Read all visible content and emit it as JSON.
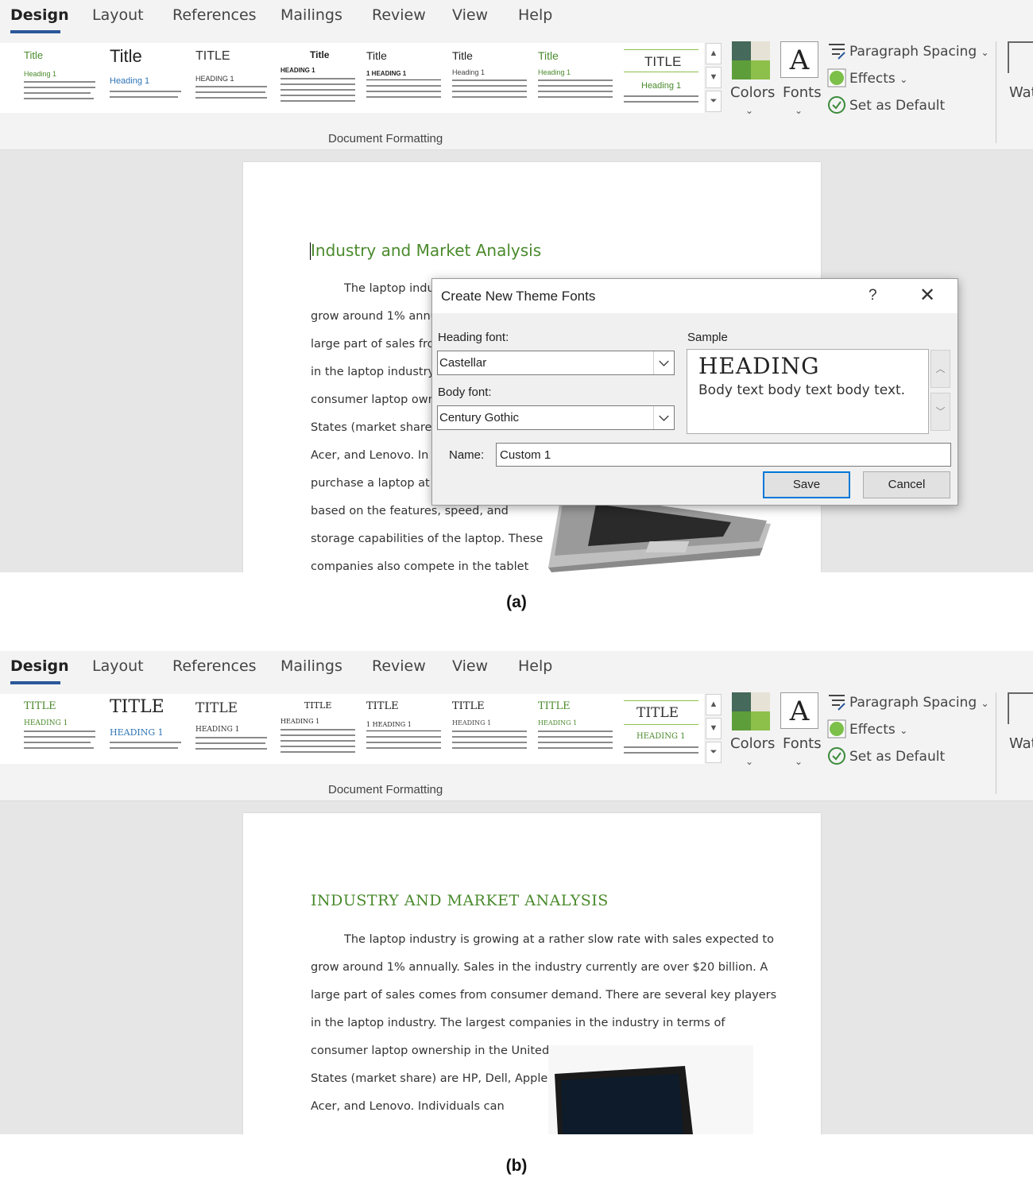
{
  "ribbon": {
    "tabs": [
      "Design",
      "Layout",
      "References",
      "Mailings",
      "Review",
      "View",
      "Help"
    ],
    "colors_label": "Colors",
    "fonts_label": "Fonts",
    "paragraph_spacing": "Paragraph Spacing",
    "effects": "Effects",
    "set_as_default": "Set as Default",
    "watermark_partial": "Wat",
    "group_label": "Document Formatting",
    "theme_colors": [
      "#45695a",
      "#e6e2d6",
      "#5e9e3a",
      "#8cc04a"
    ]
  },
  "panel_a": {
    "caption": "(a)",
    "gallery": [
      {
        "title": "Title",
        "heading": "Heading 1"
      },
      {
        "title": "Title",
        "heading": "Heading 1"
      },
      {
        "title": "TITLE",
        "heading": "HEADING 1"
      },
      {
        "title": "Title",
        "heading": "HEADING 1"
      },
      {
        "title": "Title",
        "heading": "1 HEADING 1"
      },
      {
        "title": "Title",
        "heading": "Heading 1"
      },
      {
        "title": "Title",
        "heading": "Heading 1"
      },
      {
        "title": "TITLE",
        "heading": "Heading 1"
      }
    ],
    "document": {
      "heading": "Industry and Market Analysis",
      "lines": [
        "The laptop indu",
        "grow around 1% annu",
        "large part of sales fror",
        "in the laptop industry.",
        "consumer laptop own",
        "States (market share)",
        "Acer, and Lenovo.  In",
        "purchase a laptop at",
        "based on the features, speed, and",
        "storage capabilities of the laptop. These",
        "companies also compete in the tablet"
      ]
    },
    "dialog": {
      "title": "Create New Theme Fonts",
      "help": "?",
      "close": "✕",
      "heading_font_label": "Heading font:",
      "heading_font_value": "Castellar",
      "body_font_label": "Body font:",
      "body_font_value": "Century Gothic",
      "sample_label": "Sample",
      "sample_heading": "HEADING",
      "sample_body": "Body text body text body text.",
      "name_label": "Name:",
      "name_value": "Custom 1",
      "save": "Save",
      "cancel": "Cancel"
    }
  },
  "panel_b": {
    "caption": "(b)",
    "gallery": [
      {
        "title": "TITLE",
        "heading": "HEADING 1"
      },
      {
        "title": "TITLE",
        "heading": "HEADING 1"
      },
      {
        "title": "TITLE",
        "heading": "HEADING 1"
      },
      {
        "title": "TITLE",
        "heading": "HEADING 1"
      },
      {
        "title": "TITLE",
        "heading": "1 HEADING 1"
      },
      {
        "title": "TITLE",
        "heading": "HEADING 1"
      },
      {
        "title": "TITLE",
        "heading": "HEADING 1"
      },
      {
        "title": "TITLE",
        "heading": "HEADING 1"
      }
    ],
    "document": {
      "heading": "INDUSTRY AND MARKET ANALYSIS",
      "lines": [
        "The laptop industry is growing at a rather slow rate with sales expected to",
        "grow around 1% annually.  Sales in the industry currently are over $20 billion.  A",
        "large part of sales comes from consumer demand. There are several key players",
        "in the laptop industry.  The largest companies in the industry in terms of",
        "consumer laptop ownership in the United",
        "States (market share) are HP, Dell, Apple,",
        "Acer, and Lenovo.  Individuals can"
      ]
    }
  }
}
